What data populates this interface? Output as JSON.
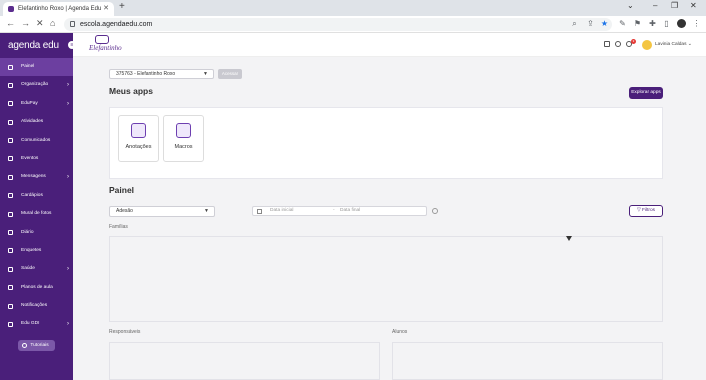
{
  "browser": {
    "tab_title": "Elefantinho Roxo | Agenda Edu",
    "url": "escola.agendaedu.com"
  },
  "sidebar": {
    "logo": "agenda edu",
    "items": [
      {
        "label": "Painel",
        "active": true,
        "arrow": false
      },
      {
        "label": "Organização",
        "active": false,
        "arrow": true
      },
      {
        "label": "EduPay",
        "active": false,
        "arrow": true
      },
      {
        "label": "Atividades",
        "active": false,
        "arrow": false
      },
      {
        "label": "Comunicados",
        "active": false,
        "arrow": false
      },
      {
        "label": "Eventos",
        "active": false,
        "arrow": false
      },
      {
        "label": "Mensagens",
        "active": false,
        "arrow": true
      },
      {
        "label": "Cardápios",
        "active": false,
        "arrow": false
      },
      {
        "label": "Mural de fotos",
        "active": false,
        "arrow": false
      },
      {
        "label": "Diário",
        "active": false,
        "arrow": false
      },
      {
        "label": "Enquetes",
        "active": false,
        "arrow": false
      },
      {
        "label": "Saúde",
        "active": false,
        "arrow": true
      },
      {
        "label": "Planos de aula",
        "active": false,
        "arrow": false
      },
      {
        "label": "Notificações",
        "active": false,
        "arrow": false
      },
      {
        "label": "Edu GDI",
        "active": false,
        "arrow": true
      }
    ],
    "tutorial_label": "Tutoriais"
  },
  "header": {
    "brand": "Elefantinho",
    "notification_count": "3",
    "user_name": "Lavinia Caldas"
  },
  "main": {
    "school_select": "375763 - Elefantinho Roxo",
    "apply_button": "Acessar",
    "apps_title": "Meus apps",
    "explore_button": "Explorar apps",
    "apps": [
      {
        "label": "Anotações",
        "icon": "book-icon"
      },
      {
        "label": "Macros",
        "icon": "chat-icon"
      }
    ],
    "panel_title": "Painel",
    "filter_select": "Adesão",
    "date_start_placeholder": "Data inicial",
    "date_sep": "-",
    "date_end_placeholder": "Data final",
    "filters_button": "Filtros",
    "families_label": "Famílias",
    "responsibles_label": "Responsáveis",
    "students_label": "Alunos"
  },
  "colors": {
    "sidebar": "#4a1f7a",
    "sidebar_active": "#6c3fa0",
    "accent": "#4a1f7a"
  }
}
